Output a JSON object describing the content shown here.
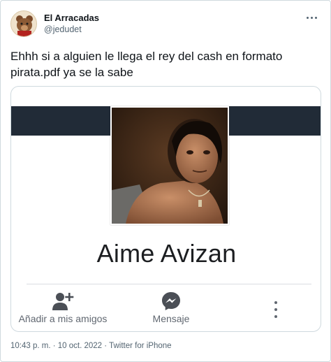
{
  "author": {
    "display_name": "El Arracadas",
    "handle": "@jedudet",
    "avatar_icon": "bear-avatar-icon"
  },
  "tweet": {
    "text": "Ehhh si a alguien le llega el rey del cash en formato pirata.pdf ya se la sabe"
  },
  "card": {
    "profile_name": "Aime Avizan",
    "cover_color": "#212b37",
    "actions": {
      "add_friend_label": "Añadir a mis amigos",
      "message_label": "Mensaje"
    }
  },
  "meta": {
    "timestamp": "10:43 p. m. · 10 oct. 2022 · Twitter for iPhone"
  },
  "colors": {
    "text_primary": "#0f1419",
    "text_secondary": "#536471",
    "facebook_label": "#606770"
  }
}
